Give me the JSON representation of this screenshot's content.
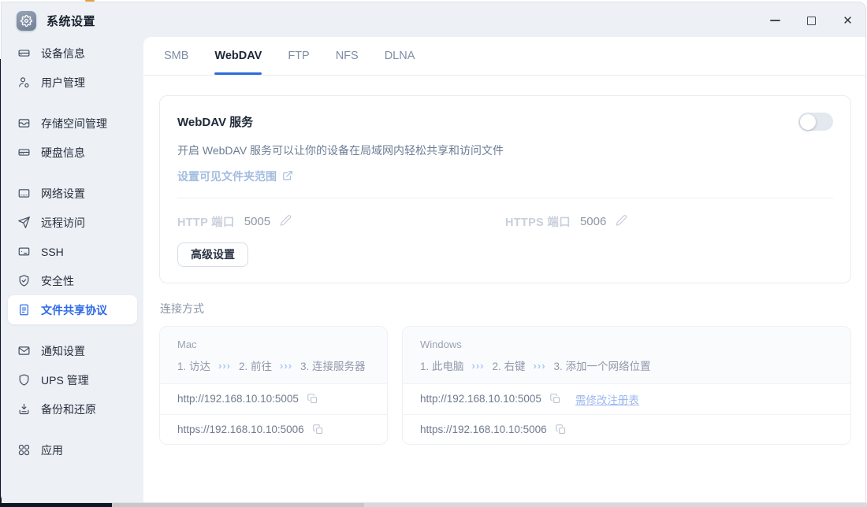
{
  "window": {
    "title": "系统设置",
    "controls": [
      {
        "name": "minimize-icon"
      },
      {
        "name": "maximize-icon"
      },
      {
        "name": "close-icon"
      }
    ]
  },
  "sidebar": {
    "groups": [
      {
        "items": [
          {
            "label": "设备信息",
            "icon": "device-info-icon",
            "active": false
          },
          {
            "label": "用户管理",
            "icon": "users-icon",
            "active": false
          }
        ]
      },
      {
        "items": [
          {
            "label": "存储空间管理",
            "icon": "storage-icon",
            "active": false
          },
          {
            "label": "硬盘信息",
            "icon": "disk-icon",
            "active": false
          }
        ]
      },
      {
        "items": [
          {
            "label": "网络设置",
            "icon": "network-icon",
            "active": false
          },
          {
            "label": "远程访问",
            "icon": "remote-icon",
            "active": false
          },
          {
            "label": "SSH",
            "icon": "ssh-icon",
            "active": false
          },
          {
            "label": "安全性",
            "icon": "security-icon",
            "active": false
          },
          {
            "label": "文件共享协议",
            "icon": "file-share-icon",
            "active": true
          }
        ]
      },
      {
        "items": [
          {
            "label": "通知设置",
            "icon": "notification-icon",
            "active": false
          },
          {
            "label": "UPS 管理",
            "icon": "ups-icon",
            "active": false
          },
          {
            "label": "备份和还原",
            "icon": "backup-icon",
            "active": false
          }
        ]
      },
      {
        "items": [
          {
            "label": "应用",
            "icon": "apps-icon",
            "active": false
          }
        ]
      }
    ]
  },
  "tabs": [
    {
      "label": "SMB",
      "active": false
    },
    {
      "label": "WebDAV",
      "active": true
    },
    {
      "label": "FTP",
      "active": false
    },
    {
      "label": "NFS",
      "active": false
    },
    {
      "label": "DLNA",
      "active": false
    }
  ],
  "service_card": {
    "title": "WebDAV 服务",
    "toggle_on": false,
    "description": "开启 WebDAV 服务可以让你的设备在局域网内轻松共享和访问文件",
    "folder_link_label": "设置可见文件夹范围",
    "http_port_label": "HTTP 端口",
    "http_port_value": "5005",
    "https_port_label": "HTTPS 端口",
    "https_port_value": "5006",
    "advanced_button_label": "高级设置"
  },
  "connection": {
    "section_title": "连接方式",
    "chevron": "›››",
    "cards": [
      {
        "os": "Mac",
        "steps": [
          "1. 访达",
          "2. 前往",
          "3. 连接服务器"
        ],
        "urls": [
          {
            "url": "http://192.168.10.10:5005",
            "note": ""
          },
          {
            "url": "https://192.168.10.10:5006",
            "note": ""
          }
        ]
      },
      {
        "os": "Windows",
        "steps": [
          "1. 此电脑",
          "2. 右键",
          "3. 添加一个网络位置"
        ],
        "urls": [
          {
            "url": "http://192.168.10.10:5005",
            "note": "需修改注册表"
          },
          {
            "url": "https://192.168.10.10:5006",
            "note": ""
          }
        ]
      }
    ]
  },
  "colors": {
    "accent_blue": "#2e6be6",
    "tab_underline": "#2a6bdf",
    "sidebar_bg": "#edf1f6",
    "disabled_link": "#a2bcdf",
    "note_link": "#9db9ee",
    "toggle_off_bg": "#e4e8ef",
    "backdrop_dark": "#0d1626"
  }
}
